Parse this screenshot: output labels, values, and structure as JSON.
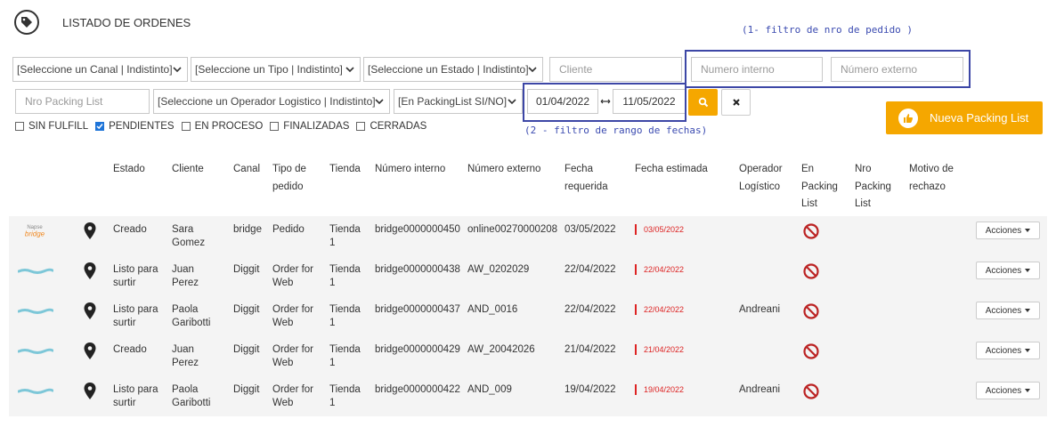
{
  "header": {
    "title": "LISTADO DE ORDENES",
    "icon": "tag-icon"
  },
  "annotations": {
    "note_1": "(1- filtro de nro de pedido )",
    "note_2": "(2 - filtro de rango de fechas)",
    "color": "#3d47a6"
  },
  "filters": {
    "canal": "[Seleccione un Canal | Indistinto]",
    "tipo": "[Seleccione un Tipo | Indistinto]",
    "estado": "[Seleccione un Estado | Indistinto]",
    "cliente_placeholder": "Cliente",
    "numero_interno_placeholder": "Numero interno",
    "numero_externo_placeholder": "Número externo",
    "packing_placeholder": "Nro Packing List",
    "operador": "[Seleccione un Operador Logistico | Indistinto]",
    "en_packing": "[En PackingList SI/NO]",
    "fecha_desde": "01/04/2022",
    "fecha_hasta": "11/05/2022"
  },
  "buttons": {
    "nueva_packing": "Nueva Packing List",
    "accent": "#f5a700"
  },
  "checks": [
    {
      "label": "SIN FULFILL",
      "checked": false
    },
    {
      "label": "PENDIENTES",
      "checked": true
    },
    {
      "label": "EN PROCESO",
      "checked": false
    },
    {
      "label": "FINALIZADAS",
      "checked": false
    },
    {
      "label": "CERRADAS",
      "checked": false
    }
  ],
  "table": {
    "headers": {
      "estado": "Estado",
      "cliente": "Cliente",
      "canal": "Canal",
      "tipo": "Tipo de\npedido",
      "tienda": "Tienda",
      "interno": "Número interno",
      "externo": "Número externo",
      "fecha_req": "Fecha\nrequerida",
      "fecha_est": "Fecha estimada",
      "operador": "Operador\nLogístico",
      "en_packing": "En\nPacking\nList",
      "nro_packing": "Nro\nPacking\nList",
      "motivo": "Motivo de\nrechazo"
    },
    "rows": [
      {
        "logo": "Napse bridge",
        "estado": "Creado",
        "cliente": "Sara\nGomez",
        "canal": "bridge",
        "tipo": "Pedido",
        "tienda": "Tienda\n1",
        "interno": "bridge0000000450",
        "externo": "online00270000208",
        "fecha_req": "03/05/2022",
        "fecha_est": "03/05/2022",
        "operador": "",
        "acciones": "Acciones"
      },
      {
        "logo": "diggit",
        "estado": "Listo para\nsurtir",
        "cliente": "Juan\nPerez",
        "canal": "Diggit",
        "tipo": "Order for\nWeb",
        "tienda": "Tienda\n1",
        "interno": "bridge0000000438",
        "externo": "AW_0202029",
        "fecha_req": "22/04/2022",
        "fecha_est": "22/04/2022",
        "operador": "",
        "acciones": "Acciones"
      },
      {
        "logo": "diggit",
        "estado": "Listo para\nsurtir",
        "cliente": "Paola\nGaribotti",
        "canal": "Diggit",
        "tipo": "Order for\nWeb",
        "tienda": "Tienda\n1",
        "interno": "bridge0000000437",
        "externo": "AND_0016",
        "fecha_req": "22/04/2022",
        "fecha_est": "22/04/2022",
        "operador": "Andreani",
        "acciones": "Acciones"
      },
      {
        "logo": "diggit",
        "estado": "Creado",
        "cliente": "Juan\nPerez",
        "canal": "Diggit",
        "tipo": "Order for\nWeb",
        "tienda": "Tienda\n1",
        "interno": "bridge0000000429",
        "externo": "AW_20042026",
        "fecha_req": "21/04/2022",
        "fecha_est": "21/04/2022",
        "operador": "",
        "acciones": "Acciones"
      },
      {
        "logo": "diggit",
        "estado": "Listo para\nsurtir",
        "cliente": "Paola\nGaribotti",
        "canal": "Diggit",
        "tipo": "Order for\nWeb",
        "tienda": "Tienda\n1",
        "interno": "bridge0000000422",
        "externo": "AND_009",
        "fecha_req": "19/04/2022",
        "fecha_est": "19/04/2022",
        "operador": "Andreani",
        "acciones": "Acciones"
      }
    ]
  }
}
